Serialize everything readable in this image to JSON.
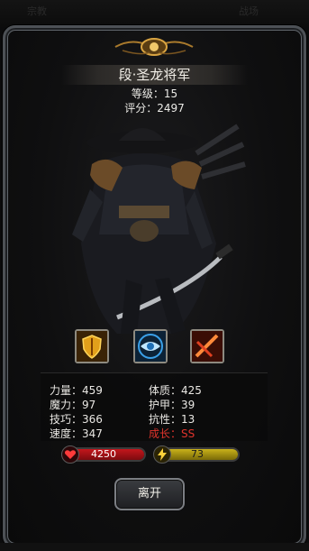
{
  "background": {
    "header_hint_left": "宗教",
    "header_hint_right": "战场"
  },
  "hero": {
    "name": "段·圣龙将军",
    "level_text": "等级：15",
    "score_text": "评分：2497"
  },
  "skills": [
    {
      "icon": "shield-icon",
      "color": "#e2a01b"
    },
    {
      "icon": "eye-icon",
      "color": "#3aa0e8"
    },
    {
      "icon": "slash-icon",
      "color": "#e04020"
    }
  ],
  "attributes": {
    "left": [
      {
        "label": "力量：459"
      },
      {
        "label": "魔力：97"
      },
      {
        "label": "技巧：366"
      },
      {
        "label": "速度：347"
      }
    ],
    "right": [
      {
        "label": "体质：425"
      },
      {
        "label": "护甲：39"
      },
      {
        "label": "抗性：13"
      },
      {
        "label": "成长：SS"
      }
    ]
  },
  "bars": {
    "hp": {
      "value": "4250",
      "fill_fraction": 1.0,
      "color": "#c4161c"
    },
    "energy": {
      "value": "73",
      "fill_fraction": 1.0,
      "color": "#c9b21a"
    }
  },
  "buttons": {
    "leave": "离开"
  },
  "colors": {
    "accent_gold": "#d9a441",
    "growth_red": "#e0342c"
  }
}
